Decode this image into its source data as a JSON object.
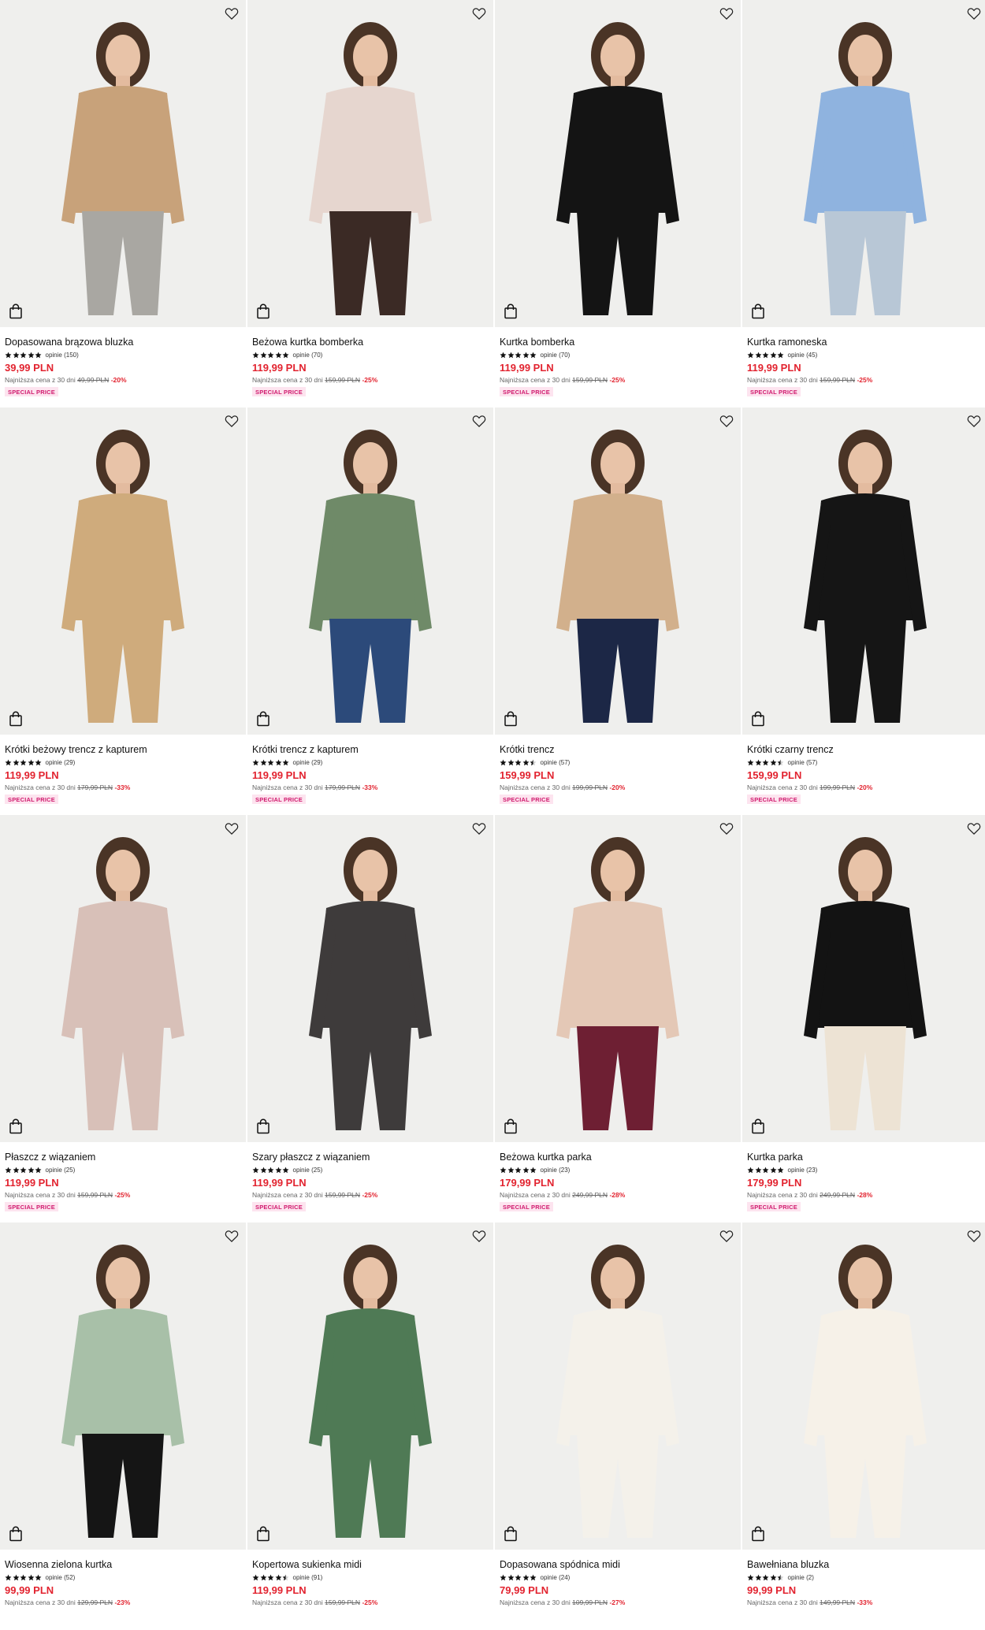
{
  "icons": {
    "wishlist": "heart-outline-icon",
    "cart": "shopping-bag-icon",
    "rating": "star-icon"
  },
  "colors": {
    "price": "#e2232f",
    "badge_bg": "#fde4ef",
    "badge_text": "#d01a6e"
  },
  "products": [
    {
      "name": "Dopasowana brązowa bluzka",
      "rating": 5,
      "reviews": "opinie (150)",
      "price": "39,99 PLN",
      "lowest_label": "Najniższa cena z 30 dni",
      "old_price": "49,99 PLN",
      "discount": "-20%",
      "badge": "SPECIAL PRICE",
      "garment": "#c8a27a",
      "bottom": "#a9a7a2"
    },
    {
      "name": "Beżowa kurtka bomberka",
      "rating": 5,
      "reviews": "opinie (70)",
      "price": "119,99 PLN",
      "lowest_label": "Najniższa cena z 30 dni",
      "old_price": "159,99 PLN",
      "discount": "-25%",
      "badge": "SPECIAL PRICE",
      "garment": "#e6d6cf",
      "bottom": "#3b2a25"
    },
    {
      "name": "Kurtka bomberka",
      "rating": 5,
      "reviews": "opinie (70)",
      "price": "119,99 PLN",
      "lowest_label": "Najniższa cena z 30 dni",
      "old_price": "159,99 PLN",
      "discount": "-25%",
      "badge": "SPECIAL PRICE",
      "garment": "#141414",
      "bottom": "#141414"
    },
    {
      "name": "Kurtka ramoneska",
      "rating": 5,
      "reviews": "opinie (45)",
      "price": "119,99 PLN",
      "lowest_label": "Najniższa cena z 30 dni",
      "old_price": "159,99 PLN",
      "discount": "-25%",
      "badge": "SPECIAL PRICE",
      "garment": "#8fb3df",
      "bottom": "#b8c7d6"
    },
    {
      "name": "Krótki beżowy trencz z kapturem",
      "rating": 5,
      "reviews": "opinie (29)",
      "price": "119,99 PLN",
      "lowest_label": "Najniższa cena z 30 dni",
      "old_price": "179,99 PLN",
      "discount": "-33%",
      "badge": "SPECIAL PRICE",
      "garment": "#cfab7c",
      "bottom": "#cfab7c"
    },
    {
      "name": "Krótki trencz z kapturem",
      "rating": 5,
      "reviews": "opinie (29)",
      "price": "119,99 PLN",
      "lowest_label": "Najniższa cena z 30 dni",
      "old_price": "179,99 PLN",
      "discount": "-33%",
      "badge": "SPECIAL PRICE",
      "garment": "#6f8a68",
      "bottom": "#2c4a7a"
    },
    {
      "name": "Krótki trencz",
      "rating": 4.5,
      "reviews": "opinie (57)",
      "price": "159,99 PLN",
      "lowest_label": "Najniższa cena z 30 dni",
      "old_price": "199,99 PLN",
      "discount": "-20%",
      "badge": "SPECIAL PRICE",
      "garment": "#d2b08c",
      "bottom": "#1c2746"
    },
    {
      "name": "Krótki czarny trencz",
      "rating": 4.5,
      "reviews": "opinie (57)",
      "price": "159,99 PLN",
      "lowest_label": "Najniższa cena z 30 dni",
      "old_price": "199,99 PLN",
      "discount": "-20%",
      "badge": "SPECIAL PRICE",
      "garment": "#151515",
      "bottom": "#151515"
    },
    {
      "name": "Płaszcz z wiązaniem",
      "rating": 5,
      "reviews": "opinie (25)",
      "price": "119,99 PLN",
      "lowest_label": "Najniższa cena z 30 dni",
      "old_price": "159,99 PLN",
      "discount": "-25%",
      "badge": "SPECIAL PRICE",
      "garment": "#d8c0b8",
      "bottom": "#d8c0b8"
    },
    {
      "name": "Szary płaszcz z wiązaniem",
      "rating": 5,
      "reviews": "opinie (25)",
      "price": "119,99 PLN",
      "lowest_label": "Najniższa cena z 30 dni",
      "old_price": "159,99 PLN",
      "discount": "-25%",
      "badge": "SPECIAL PRICE",
      "garment": "#3e3b3b",
      "bottom": "#3e3b3b"
    },
    {
      "name": "Beżowa kurtka parka",
      "rating": 5,
      "reviews": "opinie (23)",
      "price": "179,99 PLN",
      "lowest_label": "Najniższa cena z 30 dni",
      "old_price": "249,99 PLN",
      "discount": "-28%",
      "badge": "SPECIAL PRICE",
      "garment": "#e4c8b6",
      "bottom": "#6e1f33"
    },
    {
      "name": "Kurtka parka",
      "rating": 5,
      "reviews": "opinie (23)",
      "price": "179,99 PLN",
      "lowest_label": "Najniższa cena z 30 dni",
      "old_price": "249,99 PLN",
      "discount": "-28%",
      "badge": "SPECIAL PRICE",
      "garment": "#131313",
      "bottom": "#ede3d4"
    },
    {
      "name": "Wiosenna zielona kurtka",
      "rating": 5,
      "reviews": "opinie (52)",
      "price": "99,99 PLN",
      "lowest_label": "Najniższa cena z 30 dni",
      "old_price": "129,99 PLN",
      "discount": "-23%",
      "badge": "",
      "garment": "#a8c0a8",
      "bottom": "#151515"
    },
    {
      "name": "Kopertowa sukienka midi",
      "rating": 4.5,
      "reviews": "opinie (91)",
      "price": "119,99 PLN",
      "lowest_label": "Najniższa cena z 30 dni",
      "old_price": "159,99 PLN",
      "discount": "-25%",
      "badge": "",
      "garment": "#4f7a55",
      "bottom": "#4f7a55"
    },
    {
      "name": "Dopasowana spódnica midi",
      "rating": 5,
      "reviews": "opinie (24)",
      "price": "79,99 PLN",
      "lowest_label": "Najniższa cena z 30 dni",
      "old_price": "109,99 PLN",
      "discount": "-27%",
      "badge": "",
      "garment": "#f4f1ea",
      "bottom": "#f4f1ea"
    },
    {
      "name": "Bawełniana bluzka",
      "rating": 4.5,
      "reviews": "opinie (2)",
      "price": "99,99 PLN",
      "lowest_label": "Najniższa cena z 30 dni",
      "old_price": "149,99 PLN",
      "discount": "-33%",
      "badge": "",
      "garment": "#f6f1e8",
      "bottom": "#f6f1e8"
    }
  ]
}
